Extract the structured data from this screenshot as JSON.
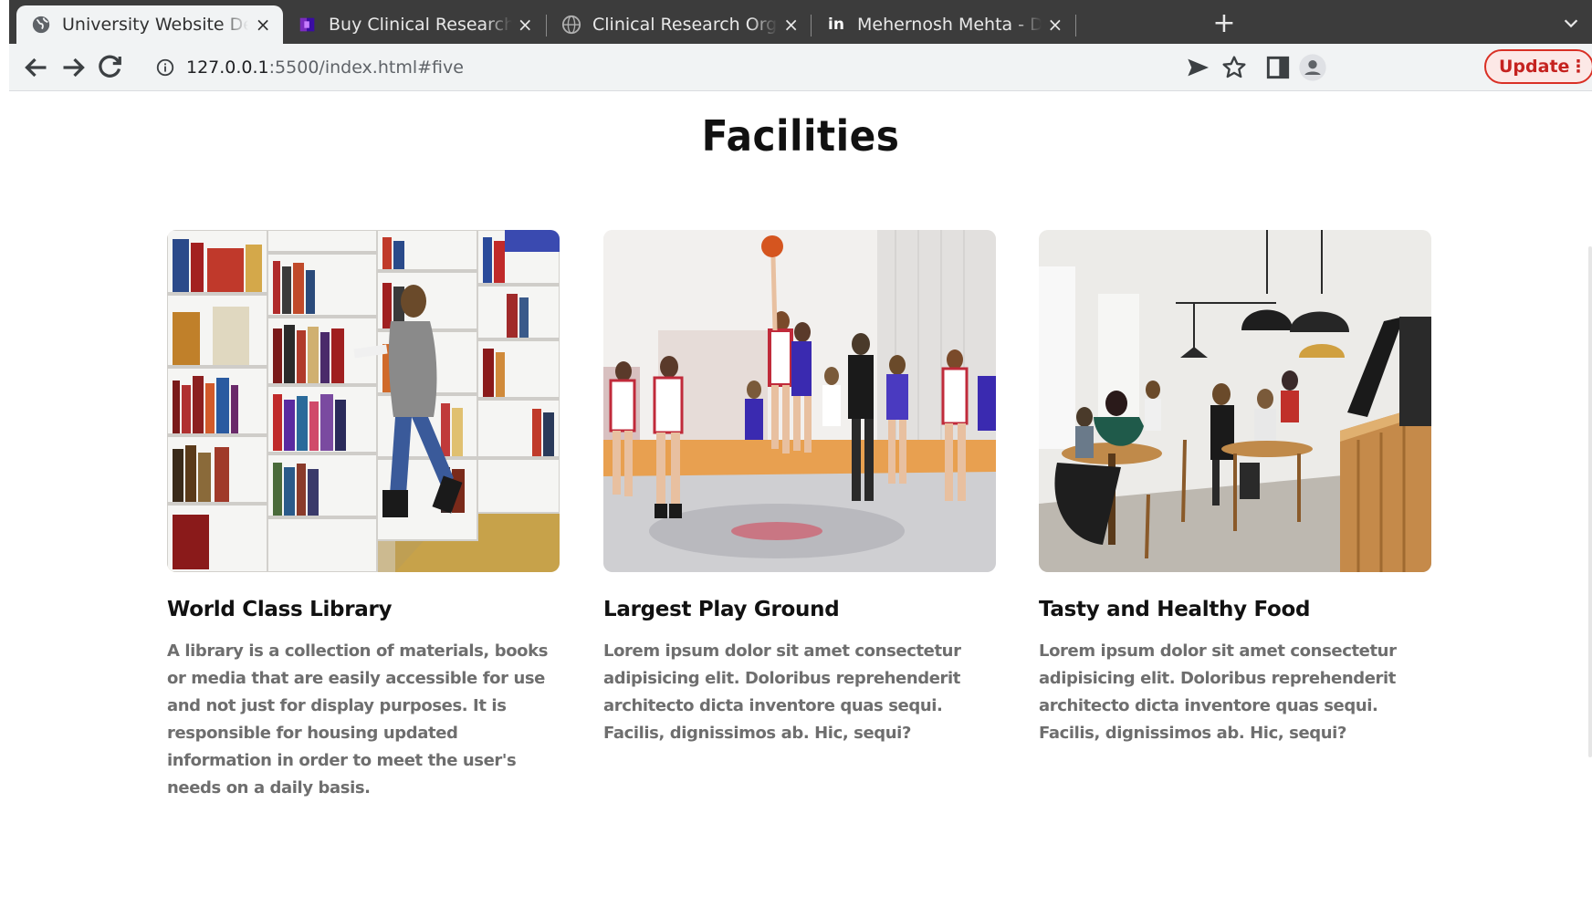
{
  "browser": {
    "tabs": [
      {
        "title": "University Website Design",
        "active": true,
        "favicon": "globe-icon"
      },
      {
        "title": "Buy Clinical Research Course",
        "active": false,
        "favicon": "course-logo-icon"
      },
      {
        "title": "Clinical Research Organization",
        "active": false,
        "favicon": "globe-logo-icon"
      },
      {
        "title": "Mehernosh Mehta - Director",
        "active": false,
        "favicon": "linkedin-icon"
      }
    ],
    "close_glyph": "×",
    "new_tab_glyph": "+",
    "url_host": "127.0.0.1",
    "url_path": ":5500/index.html#five",
    "update_label": "Update",
    "menu_glyph": "⋮",
    "linkedin_letters": "in"
  },
  "page": {
    "section_title": "Facilities",
    "cards": [
      {
        "title": "World Class Library",
        "text": "A library is a collection of materials, books or media that are easily accessible for use and not just for display purposes. It is responsible for housing updated information in order to meet the user's needs on a daily basis.",
        "image": "library-photo"
      },
      {
        "title": "Largest Play Ground",
        "text": "Lorem ipsum dolor sit amet consectetur adipisicing elit. Doloribus reprehenderit architecto dicta inventore quas sequi. Facilis, dignissimos ab. Hic, sequi?",
        "image": "basketball-photo"
      },
      {
        "title": "Tasty and Healthy Food",
        "text": "Lorem ipsum dolor sit amet consectetur adipisicing elit. Doloribus reprehenderit architecto dicta inventore quas sequi. Facilis, dignissimos ab. Hic, sequi?",
        "image": "cafeteria-photo"
      }
    ]
  },
  "colors": {
    "tabbar": "#3c3c3c",
    "toolbar": "#f1f3f4",
    "update_accent": "#d93025",
    "heading": "#111111",
    "body_text": "#6e6e6e"
  }
}
